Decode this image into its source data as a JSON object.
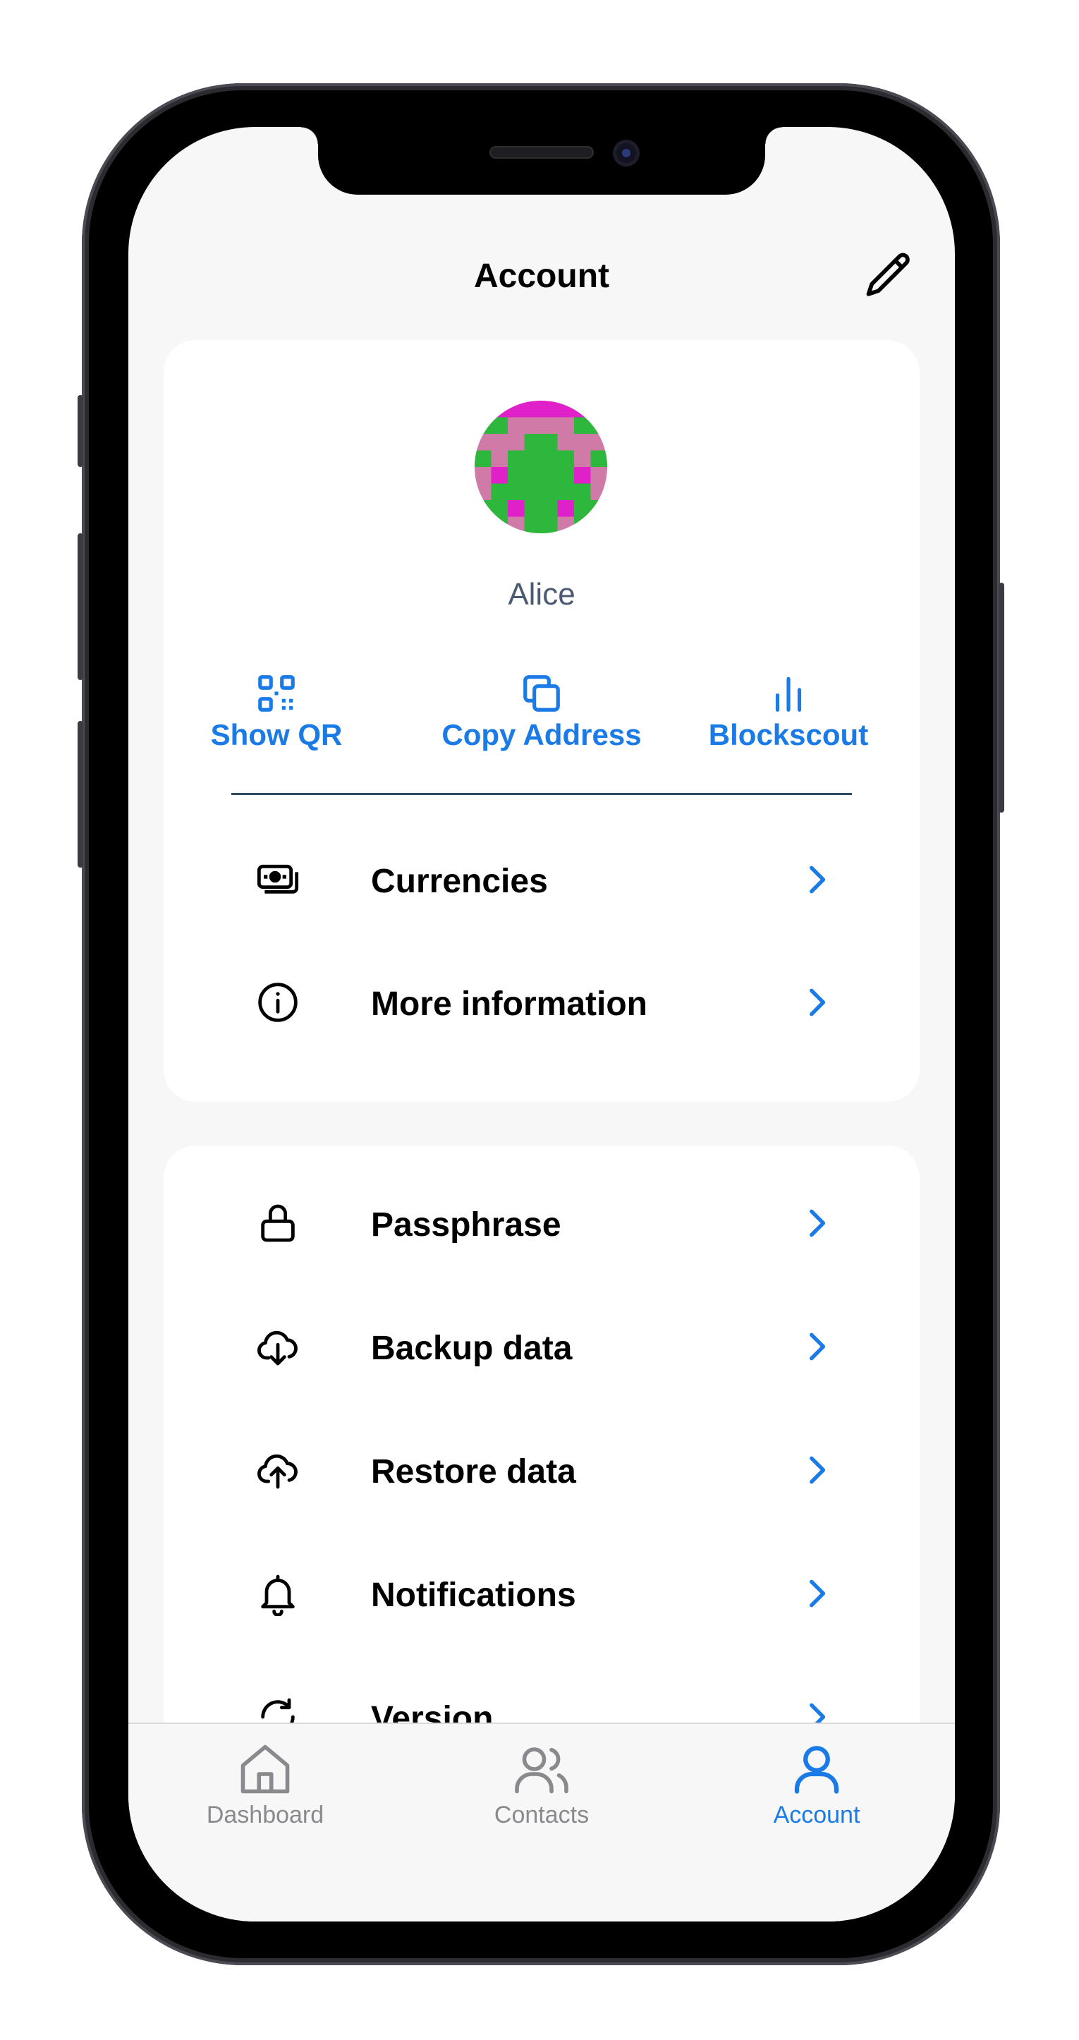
{
  "header": {
    "title": "Account"
  },
  "profile": {
    "name": "Alice"
  },
  "actions": [
    {
      "label": "Show QR",
      "icon": "qr-code-icon"
    },
    {
      "label": "Copy Address",
      "icon": "copy-icon"
    },
    {
      "label": "Blockscout",
      "icon": "bar-chart-icon"
    }
  ],
  "card1_rows": [
    {
      "label": "Currencies",
      "icon": "banknotes-icon"
    },
    {
      "label": "More information",
      "icon": "info-icon"
    }
  ],
  "card2_rows": [
    {
      "label": "Passphrase",
      "icon": "lock-icon"
    },
    {
      "label": "Backup data",
      "icon": "cloud-download-icon"
    },
    {
      "label": "Restore data",
      "icon": "cloud-upload-icon"
    },
    {
      "label": "Notifications",
      "icon": "bell-icon"
    },
    {
      "label": "Version",
      "icon": "refresh-icon"
    }
  ],
  "tabs": [
    {
      "label": "Dashboard",
      "icon": "home-icon",
      "active": false
    },
    {
      "label": "Contacts",
      "icon": "users-icon",
      "active": false
    },
    {
      "label": "Account",
      "icon": "user-icon",
      "active": true
    }
  ],
  "colors": {
    "accent": "#1a7be6",
    "inactive_tab": "#8a8a8e",
    "avatar_magenta": "#e020c8",
    "avatar_pink": "#d07aa8",
    "avatar_green": "#2db83d"
  }
}
